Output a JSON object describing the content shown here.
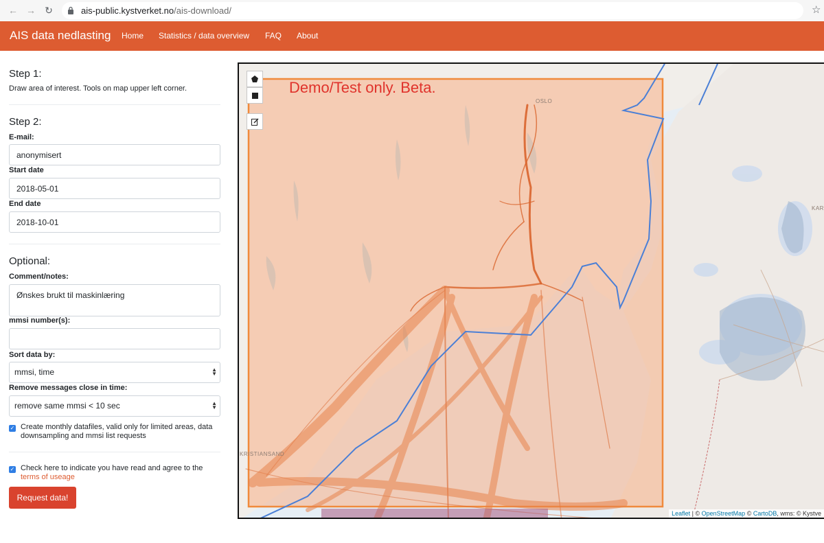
{
  "browser": {
    "url_host": "ais-public.kystverket.no",
    "url_path": "/ais-download/"
  },
  "navbar": {
    "brand": "AIS data nedlasting",
    "links": [
      "Home",
      "Statistics / data overview",
      "FAQ",
      "About"
    ],
    "color": "#dd5c31"
  },
  "step1": {
    "title": "Step 1:",
    "text": "Draw area of interest. Tools on map upper left corner."
  },
  "step2": {
    "title": "Step 2:",
    "email_label": "E-mail:",
    "email_value": "anonymisert",
    "start_label": "Start date",
    "start_value": "2018-05-01",
    "end_label": "End date",
    "end_value": "2018-10-01"
  },
  "optional": {
    "title": "Optional:",
    "comment_label": "Comment/notes:",
    "comment_value": "Ønskes brukt til maskinlæring",
    "mmsi_label": "mmsi number(s):",
    "mmsi_value": "",
    "sort_label": "Sort data by:",
    "sort_value": "mmsi, time",
    "remove_label": "Remove messages close in time:",
    "remove_value": "remove same mmsi < 10 sec",
    "monthly_text": "Create monthly datafiles, valid only for limited areas, data downsampling and mmsi list requests",
    "monthly_checked": true
  },
  "agree": {
    "text": "Check here to indicate you have read and agree to the",
    "link": "terms of useage",
    "checked": true
  },
  "submit_label": "Request data!",
  "map": {
    "demo_text": "Demo/Test only. Beta.",
    "place_oslo": "OSLO",
    "place_kristiansand": "KRISTIANSAND",
    "place_right": "KAR",
    "attribution": {
      "leaflet": "Leaflet",
      "sep1": " | © ",
      "osm": "OpenStreetMap",
      "sep2": " © ",
      "carto": "CartoDB",
      "rest": ", wms: © Kystve"
    },
    "selection_color": "#f08a3c",
    "track_color": "#d9642c",
    "border_color": "#4a7fd6"
  }
}
